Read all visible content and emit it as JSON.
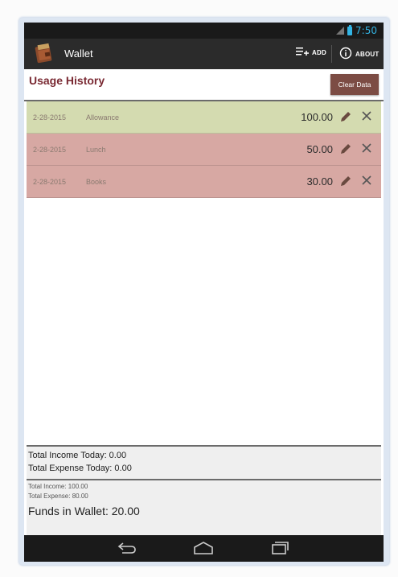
{
  "status_bar": {
    "time": "7:50",
    "signal_icon": "signal-icon",
    "battery_icon": "battery-icon"
  },
  "action_bar": {
    "app_title": "Wallet",
    "app_icon": "wallet-icon",
    "add_label": "ADD",
    "add_icon": "add-list-icon",
    "about_label": "ABOUT",
    "about_icon": "info-icon"
  },
  "header": {
    "title": "Usage History",
    "clear_label": "Clear Data"
  },
  "history": [
    {
      "date": "2-28-2015",
      "description": "Allowance",
      "amount": "100.00",
      "type": "income"
    },
    {
      "date": "2-28-2015",
      "description": "Lunch",
      "amount": "50.00",
      "type": "expense"
    },
    {
      "date": "2-28-2015",
      "description": "Books",
      "amount": "30.00",
      "type": "expense"
    }
  ],
  "totals_today": {
    "income": "Total Income Today: 0.00",
    "expense": "Total Expense Today: 0.00"
  },
  "totals_all": {
    "income": "Total Income: 100.00",
    "expense": "Total Expense: 80.00",
    "funds": "Funds in Wallet: 20.00"
  },
  "colors": {
    "income_row": "#d4dbb0",
    "expense_row": "#d7a8a3",
    "accent_title": "#7a2a33",
    "clear_button": "#7c4c44",
    "status_accent": "#33b5e5"
  },
  "nav_bar": {
    "back_icon": "back-icon",
    "home_icon": "home-icon",
    "recent_icon": "recent-apps-icon"
  }
}
